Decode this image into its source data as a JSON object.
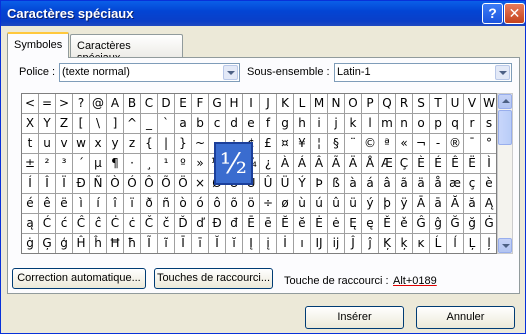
{
  "window": {
    "title": "Caractères spéciaux"
  },
  "tabs": [
    {
      "label": "Symboles"
    },
    {
      "label": "Caractères spéciaux"
    }
  ],
  "font": {
    "label": "Police :",
    "value": "(texte normal)"
  },
  "subset": {
    "label": "Sous-ensemble :",
    "value": "Latin-1"
  },
  "zoom_char": "½",
  "grid_rows": [
    [
      "<",
      "=",
      ">",
      "?",
      "@",
      "A",
      "B",
      "C",
      "D",
      "E",
      "F",
      "G",
      "H",
      "I",
      "J",
      "K",
      "L",
      "M",
      "N",
      "O",
      "P",
      "Q",
      "R",
      "S",
      "T",
      "U",
      "V",
      "W"
    ],
    [
      "X",
      "Y",
      "Z",
      "[",
      "\\",
      "]",
      "^",
      "_",
      "`",
      "a",
      "b",
      "c",
      "d",
      "e",
      "f",
      "g",
      "h",
      "i",
      "j",
      "k",
      "l",
      "m",
      "n",
      "o",
      "p",
      "q",
      "r",
      "s"
    ],
    [
      "t",
      "u",
      "v",
      "w",
      "x",
      "y",
      "z",
      "{",
      "|",
      "}",
      "~",
      "",
      "¡",
      "¢",
      "£",
      "¤",
      "¥",
      "¦",
      "§",
      "¨",
      "©",
      "ª",
      "«",
      "¬",
      "-",
      "®",
      "¯",
      "°"
    ],
    [
      "±",
      "²",
      "³",
      "´",
      "µ",
      "¶",
      "·",
      "¸",
      "¹",
      "º",
      "»",
      "¼",
      "½",
      "¾",
      "¿",
      "À",
      "Á",
      "Â",
      "Ã",
      "Ä",
      "Å",
      "Æ",
      "Ç",
      "È",
      "É",
      "Ê",
      "Ë",
      "Ì"
    ],
    [
      "Í",
      "Î",
      "Ï",
      "Ð",
      "Ñ",
      "Ò",
      "Ó",
      "Ô",
      "Õ",
      "Ö",
      "×",
      "Ø",
      "Ù",
      "Ú",
      "Û",
      "Ü",
      "Ý",
      "Þ",
      "ß",
      "à",
      "á",
      "â",
      "ã",
      "ä",
      "å",
      "æ",
      "ç",
      "è"
    ],
    [
      "é",
      "ê",
      "ë",
      "ì",
      "í",
      "î",
      "ï",
      "ð",
      "ñ",
      "ò",
      "ó",
      "ô",
      "õ",
      "ö",
      "÷",
      "ø",
      "ù",
      "ú",
      "û",
      "ü",
      "ý",
      "þ",
      "ÿ",
      "Ā",
      "ā",
      "Ă",
      "ă",
      "Ą"
    ],
    [
      "ą",
      "Ć",
      "ć",
      "Ĉ",
      "ĉ",
      "Ċ",
      "ċ",
      "Č",
      "č",
      "Ď",
      "ď",
      "Đ",
      "đ",
      "Ē",
      "ē",
      "Ĕ",
      "ĕ",
      "Ė",
      "ė",
      "Ę",
      "ę",
      "Ě",
      "ě",
      "Ĝ",
      "ĝ",
      "Ğ",
      "ğ",
      "Ġ"
    ],
    [
      "ġ",
      "Ģ",
      "ģ",
      "Ĥ",
      "ĥ",
      "Ħ",
      "ħ",
      "Ĩ",
      "ĩ",
      "Ī",
      "ī",
      "Ĭ",
      "ĭ",
      "Į",
      "į",
      "İ",
      "ı",
      "Ĳ",
      "ĳ",
      "Ĵ",
      "ĵ",
      "Ķ",
      "ķ",
      "ĸ",
      "Ĺ",
      "ĺ",
      "Ļ",
      "ļ"
    ]
  ],
  "buttons": {
    "autocorrect": "Correction automatique...",
    "shortcut_keys": "Touches de raccourci...",
    "insert": "Insérer",
    "cancel": "Annuler"
  },
  "shortcut": {
    "label": "Touche de raccourci :",
    "value": "Alt+0189"
  }
}
